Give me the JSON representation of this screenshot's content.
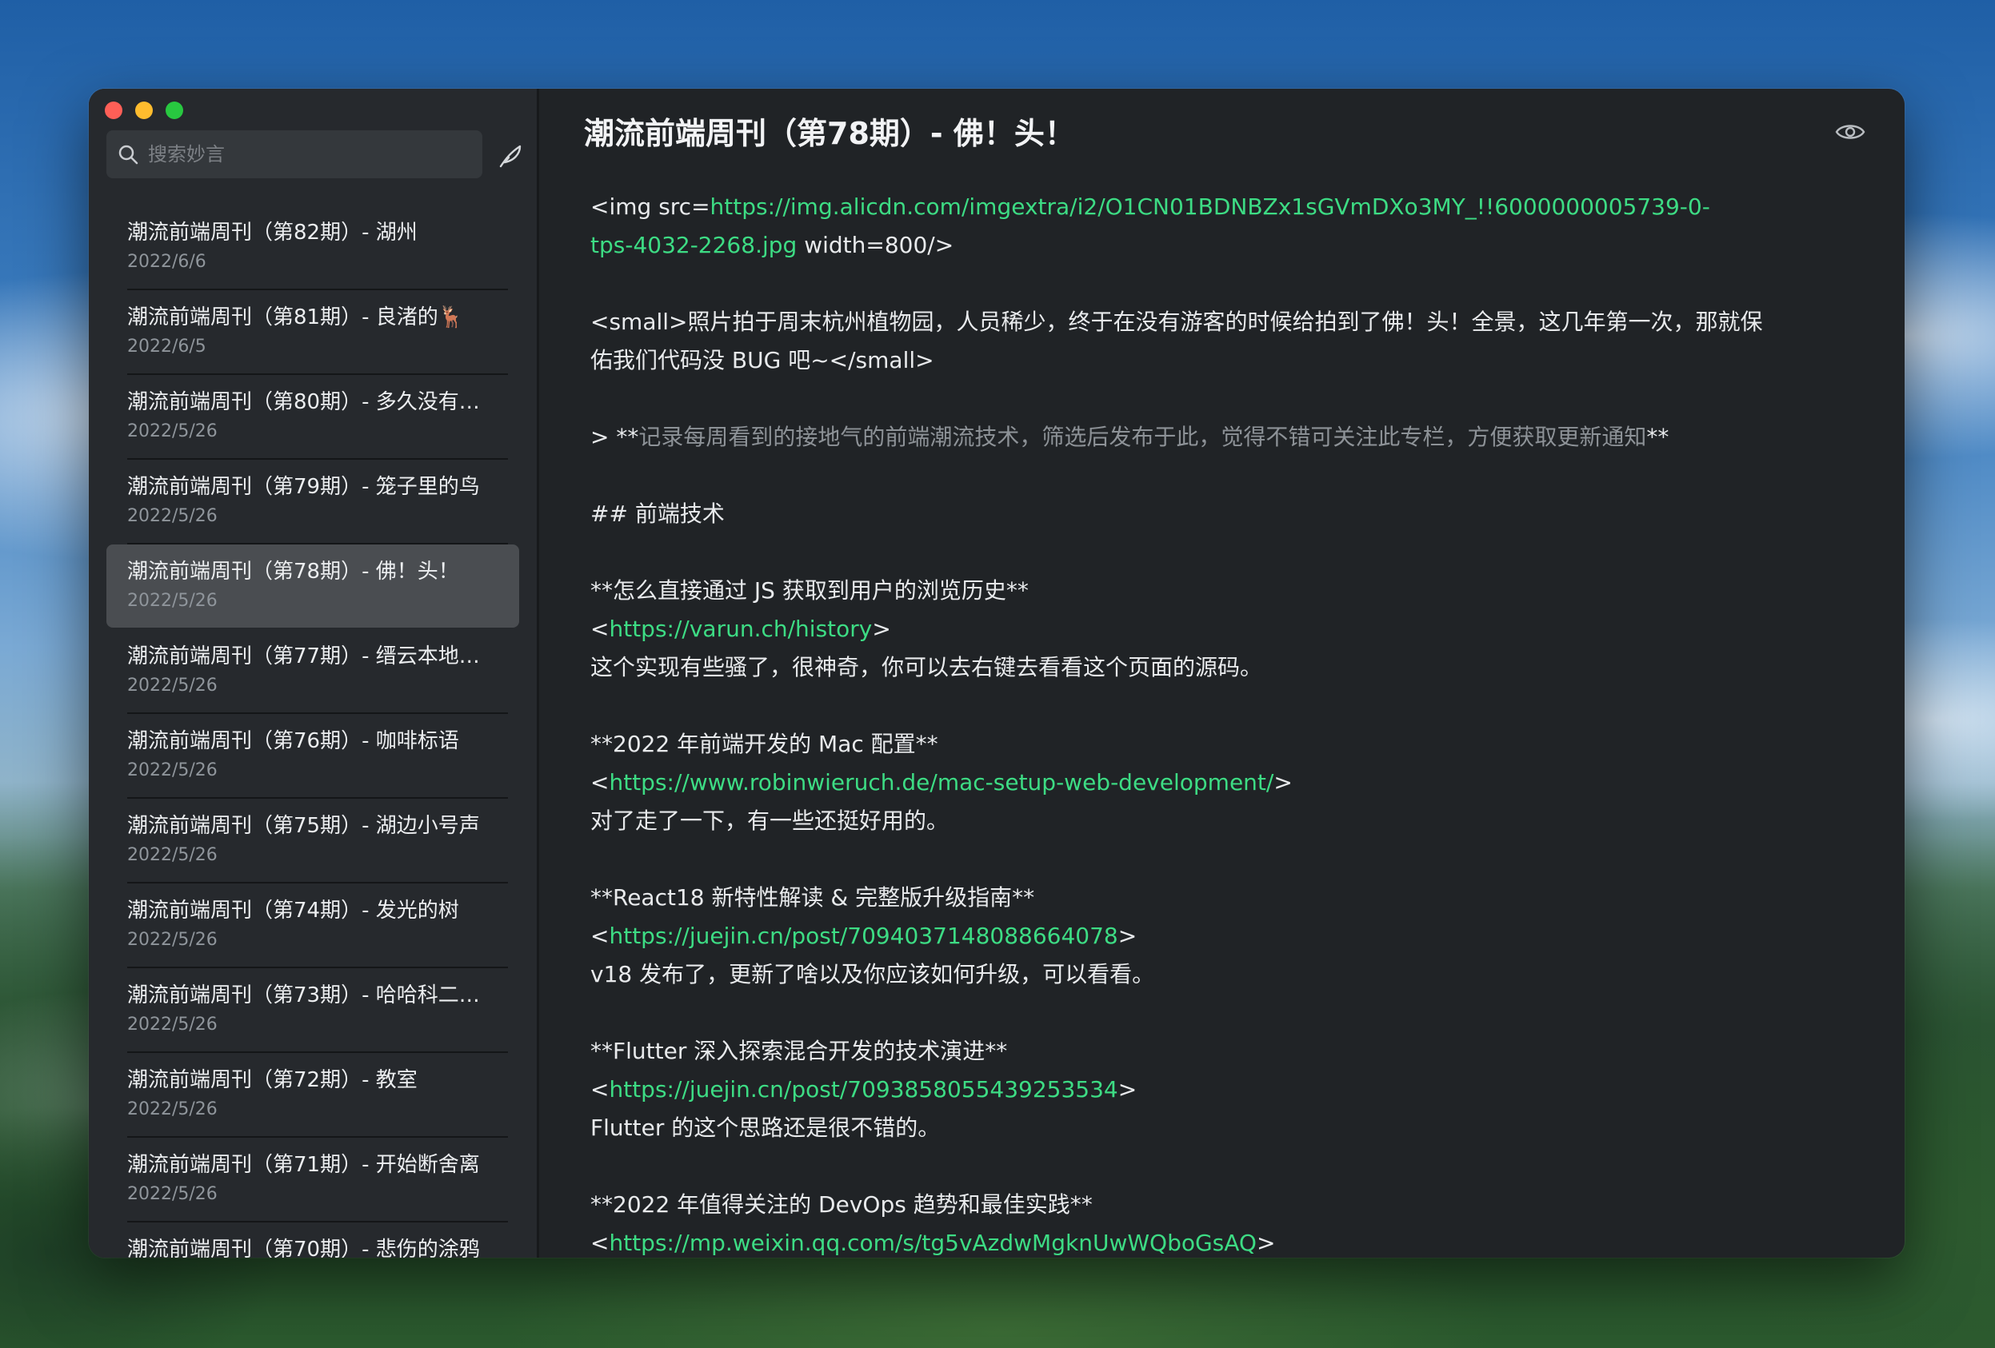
{
  "sidebar": {
    "search_placeholder": "搜索妙言",
    "items": [
      {
        "title": "潮流前端周刊（第82期）- 湖州",
        "date": "2022/6/6"
      },
      {
        "title": "潮流前端周刊（第81期）- 良渚的🦌",
        "date": "2022/6/5"
      },
      {
        "title": "潮流前端周刊（第80期）- 多久没有…",
        "date": "2022/5/26"
      },
      {
        "title": "潮流前端周刊（第79期）- 笼子里的鸟",
        "date": "2022/5/26"
      },
      {
        "title": "潮流前端周刊（第78期）- 佛！头！",
        "date": "2022/5/26"
      },
      {
        "title": "潮流前端周刊（第77期）- 缙云本地…",
        "date": "2022/5/26"
      },
      {
        "title": "潮流前端周刊（第76期）- 咖啡标语",
        "date": "2022/5/26"
      },
      {
        "title": "潮流前端周刊（第75期）- 湖边小号声",
        "date": "2022/5/26"
      },
      {
        "title": "潮流前端周刊（第74期）- 发光的树",
        "date": "2022/5/26"
      },
      {
        "title": "潮流前端周刊（第73期）- 哈哈科二…",
        "date": "2022/5/26"
      },
      {
        "title": "潮流前端周刊（第72期）- 教室",
        "date": "2022/5/26"
      },
      {
        "title": "潮流前端周刊（第71期）- 开始断舍离",
        "date": "2022/5/26"
      },
      {
        "title": "潮流前端周刊（第70期）- 悲伤的涂鸦",
        "date": ""
      }
    ],
    "active_index": 4
  },
  "editor": {
    "title": "潮流前端周刊（第78期）- 佛！头！",
    "img_prefix": "<img src=",
    "img_url_1": "https://img.alicdn.com/imgextra/i2/O1CN01BDNBZx1sGVmDXo3MY_!!6000000005739-0-",
    "img_url_2": "tps-4032-2268.jpg",
    "img_suffix": " width=800/>",
    "small_1": "<small>照片拍于周末杭州植物园，人员稀少，终于在没有游客的时候给拍到了佛！头！全景，这几年第一次，那就保",
    "small_2": "佑我们代码没 BUG 吧~</small>",
    "quote_prefix": "> **",
    "quote_text": "记录每周看到的接地气的前端潮流技术，筛选后发布于此，觉得不错可关注此专栏，方便获取更新通知",
    "quote_suffix": "**",
    "heading": "## 前端技术",
    "a1_title": "**怎么直接通过 JS 获取到用户的浏览历史**",
    "a1_url": "https://varun.ch/history",
    "a1_desc": "这个实现有些骚了，很神奇，你可以去右键去看看这个页面的源码。",
    "a2_title": "**2022 年前端开发的 Mac 配置**",
    "a2_url": "https://www.robinwieruch.de/mac-setup-web-development/",
    "a2_desc": "对了走了一下，有一些还挺好用的。",
    "a3_title": "**React18 新特性解读 & 完整版升级指南**",
    "a3_url": "https://juejin.cn/post/7094037148088664078",
    "a3_desc": "v18 发布了，更新了啥以及你应该如何升级，可以看看。",
    "a4_title": "**Flutter 深入探索混合开发的技术演进**",
    "a4_url": "https://juejin.cn/post/7093858055439253534",
    "a4_desc": "Flutter 的这个思路还是很不错的。",
    "a5_title": "**2022 年值得关注的 DevOps 趋势和最佳实践**",
    "a5_url": "https://mp.weixin.qq.com/s/tg5vAzdwMgknUwWQboGsAQ",
    "lt": "<",
    "gt": ">"
  },
  "colors": {
    "link": "#3ddc84",
    "active_item": "#4a4d51"
  }
}
